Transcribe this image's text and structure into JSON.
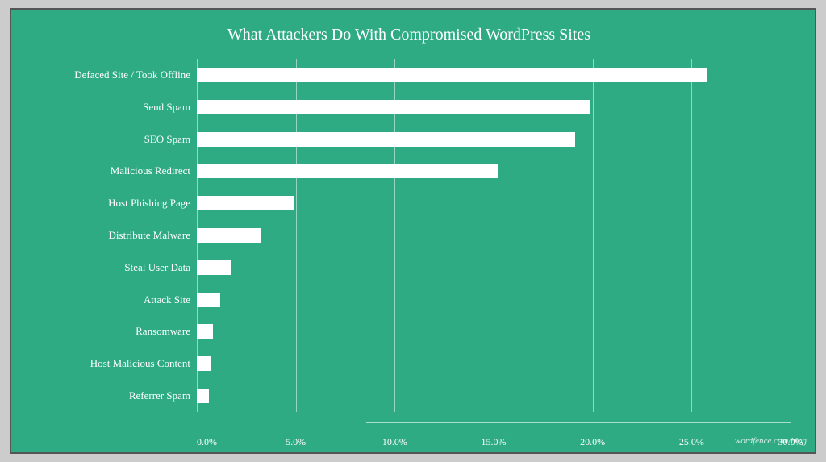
{
  "title": "What Attackers Do With Compromised WordPress Sites",
  "watermark": "wordfence.com/blog",
  "bars": [
    {
      "label": "Defaced Site / Took Offline",
      "value": 25.8,
      "maxPct": 30
    },
    {
      "label": "Send Spam",
      "value": 19.9,
      "maxPct": 30
    },
    {
      "label": "SEO Spam",
      "value": 19.1,
      "maxPct": 30
    },
    {
      "label": "Malicious Redirect",
      "value": 15.2,
      "maxPct": 30
    },
    {
      "label": "Host Phishing Page",
      "value": 4.9,
      "maxPct": 30
    },
    {
      "label": "Distribute Malware",
      "value": 3.2,
      "maxPct": 30
    },
    {
      "label": "Steal User Data",
      "value": 1.7,
      "maxPct": 30
    },
    {
      "label": "Attack Site",
      "value": 1.2,
      "maxPct": 30
    },
    {
      "label": "Ransomware",
      "value": 0.8,
      "maxPct": 30
    },
    {
      "label": "Host Malicious Content",
      "value": 0.7,
      "maxPct": 30
    },
    {
      "label": "Referrer Spam",
      "value": 0.6,
      "maxPct": 30
    }
  ],
  "xTicks": [
    "0.0%",
    "5.0%",
    "10.0%",
    "15.0%",
    "20.0%",
    "25.0%",
    "30.0%"
  ],
  "colors": {
    "background": "#2eab82",
    "bar": "#ffffff",
    "text": "#ffffff"
  }
}
